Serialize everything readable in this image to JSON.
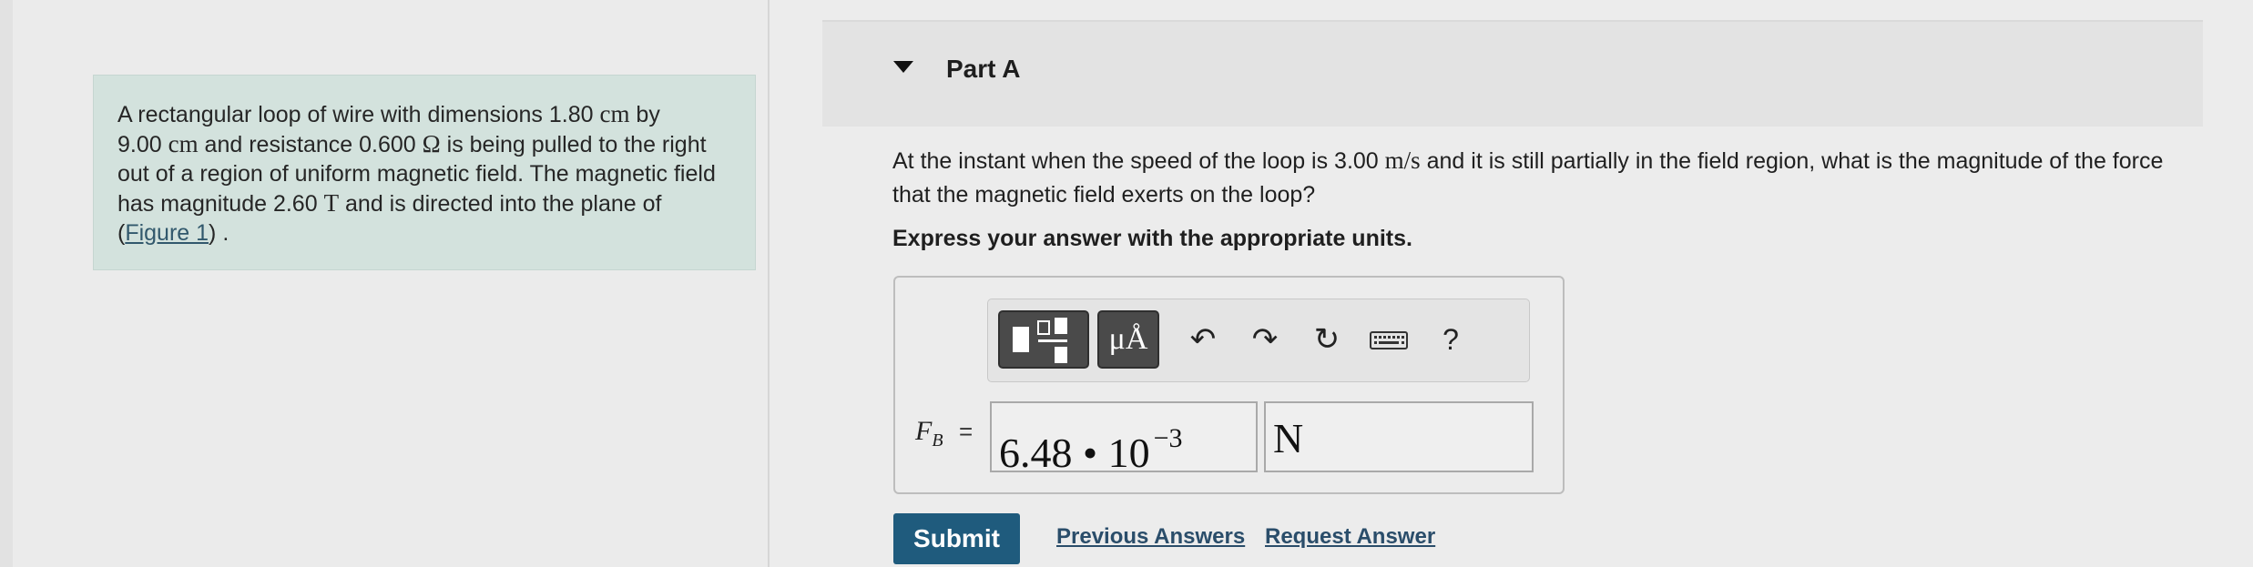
{
  "problem": {
    "text_1": "A rectangular loop of wire with dimensions 1.80 ",
    "unit_cm_1": "cm",
    "text_2": " by",
    "text_3": "9.00 ",
    "unit_cm_2": "cm",
    "text_4": " and resistance 0.600 ",
    "unit_ohm": "Ω",
    "text_5": " is being pulled to the right out of a region of uniform magnetic field. The magnetic field has magnitude 2.60 ",
    "unit_T": "T",
    "text_6": " and is directed into the plane of (",
    "figure_link": "Figure 1",
    "text_7": ") ."
  },
  "part": {
    "title": "Part A"
  },
  "question": {
    "text_1": "At the instant when the speed of the loop is 3.00 ",
    "unit_speed": "m/s",
    "text_2": " and it is still partially in the field region, what is the magnitude of the force that the magnetic field exerts on the loop?"
  },
  "instruction": "Express your answer with the appropriate units.",
  "toolbar": {
    "units_label": "μÅ",
    "undo_glyph": "↶",
    "redo_glyph": "↷",
    "reset_glyph": "↻",
    "help_label": "?",
    "icons": [
      "templates-icon",
      "units-icon",
      "undo-icon",
      "redo-icon",
      "reset-icon",
      "keyboard-icon",
      "help-icon"
    ]
  },
  "answer": {
    "label_main": "F",
    "label_sub": "B",
    "equals": "=",
    "value_mantissa": "6.48 • 10",
    "value_exponent": "−3",
    "unit": "N"
  },
  "actions": {
    "submit_label": "Submit",
    "previous_answers_label": "Previous Answers",
    "request_answer_label": "Request Answer"
  },
  "colors": {
    "submit_bg": "#1f5b7d",
    "problem_bg": "#d3e2dd",
    "link": "#2a4d6a"
  }
}
